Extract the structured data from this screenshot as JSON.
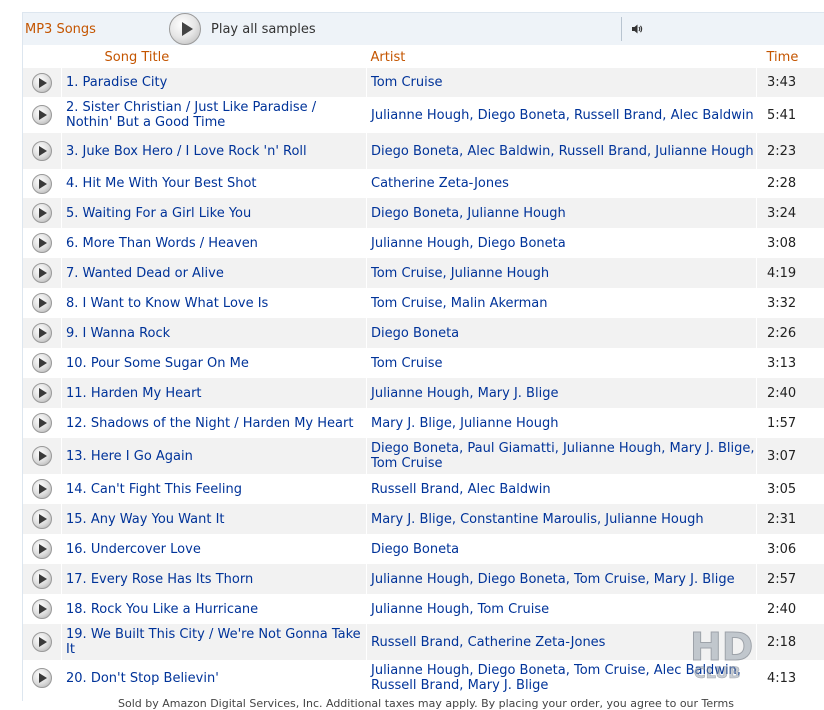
{
  "toolbar": {
    "section_title": "MP3 Songs",
    "play_all_label": "Play all samples",
    "play_icon": "play-icon",
    "volume_icon": "volume-icon"
  },
  "columns": {
    "title": "Song Title",
    "artist": "Artist",
    "time": "Time"
  },
  "tracks": [
    {
      "num": "1.",
      "title": "Paradise City",
      "artist": "Tom Cruise",
      "time": "3:43"
    },
    {
      "num": "2.",
      "title": "Sister Christian / Just Like Paradise / Nothin' But a Good Time",
      "artist": "Julianne Hough, Diego Boneta, Russell Brand, Alec Baldwin",
      "time": "5:41"
    },
    {
      "num": "3.",
      "title": "Juke Box Hero / I Love Rock 'n' Roll",
      "artist": "Diego Boneta, Alec Baldwin, Russell Brand, Julianne Hough",
      "time": "2:23"
    },
    {
      "num": "4.",
      "title": "Hit Me With Your Best Shot",
      "artist": "Catherine Zeta-Jones",
      "time": "2:28"
    },
    {
      "num": "5.",
      "title": "Waiting For a Girl Like You",
      "artist": "Diego Boneta, Julianne Hough",
      "time": "3:24"
    },
    {
      "num": "6.",
      "title": "More Than Words / Heaven",
      "artist": "Julianne Hough, Diego Boneta",
      "time": "3:08"
    },
    {
      "num": "7.",
      "title": "Wanted Dead or Alive",
      "artist": "Tom Cruise, Julianne Hough",
      "time": "4:19"
    },
    {
      "num": "8.",
      "title": "I Want to Know What Love Is",
      "artist": "Tom Cruise, Malin Akerman",
      "time": "3:32"
    },
    {
      "num": "9.",
      "title": "I Wanna Rock",
      "artist": "Diego Boneta",
      "time": "2:26"
    },
    {
      "num": "10.",
      "title": "Pour Some Sugar On Me",
      "artist": "Tom Cruise",
      "time": "3:13"
    },
    {
      "num": "11.",
      "title": "Harden My Heart",
      "artist": "Julianne Hough, Mary J. Blige",
      "time": "2:40"
    },
    {
      "num": "12.",
      "title": "Shadows of the Night / Harden My Heart",
      "artist": "Mary J. Blige, Julianne Hough",
      "time": "1:57"
    },
    {
      "num": "13.",
      "title": "Here I Go Again",
      "artist": "Diego Boneta, Paul Giamatti, Julianne Hough, Mary J. Blige, Tom Cruise",
      "time": "3:07"
    },
    {
      "num": "14.",
      "title": "Can't Fight This Feeling",
      "artist": "Russell Brand, Alec Baldwin",
      "time": "3:05"
    },
    {
      "num": "15.",
      "title": "Any Way You Want It",
      "artist": "Mary J. Blige, Constantine Maroulis, Julianne Hough",
      "time": "2:31"
    },
    {
      "num": "16.",
      "title": "Undercover Love",
      "artist": "Diego Boneta",
      "time": "3:06"
    },
    {
      "num": "17.",
      "title": "Every Rose Has Its Thorn",
      "artist": "Julianne Hough, Diego Boneta, Tom Cruise, Mary J. Blige",
      "time": "2:57"
    },
    {
      "num": "18.",
      "title": "Rock You Like a Hurricane",
      "artist": "Julianne Hough, Tom Cruise",
      "time": "2:40"
    },
    {
      "num": "19.",
      "title": "We Built This City / We're Not Gonna Take It",
      "artist": "Russell Brand, Catherine Zeta-Jones",
      "time": "2:18"
    },
    {
      "num": "20.",
      "title": "Don't Stop Believin'",
      "artist": "Julianne Hough, Diego Boneta, Tom Cruise, Alec Baldwin, Russell Brand, Mary J. Blige",
      "time": "4:13"
    }
  ],
  "footer": {
    "text": "Sold by Amazon Digital Services, Inc. Additional taxes may apply. By placing your order, you agree to our Terms"
  },
  "watermark": {
    "text": "HD CLUB"
  },
  "colors": {
    "accent": "#c45500",
    "link": "#003399",
    "toolbar_bg": "#eef3f8",
    "row_alt_bg": "#f2f2f2"
  }
}
